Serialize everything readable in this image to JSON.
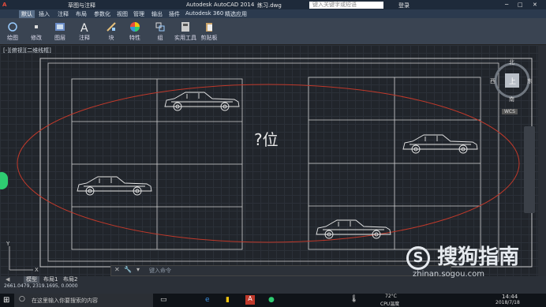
{
  "titlebar": {
    "workspace": "草图与注释",
    "app_title": "Autodesk AutoCAD 2014",
    "file": "练习.dwg",
    "search_placeholder": "键入关键字或短语",
    "login": "登录"
  },
  "tabs": [
    "默认",
    "插入",
    "注释",
    "布局",
    "参数化",
    "视图",
    "管理",
    "输出",
    "插件",
    "Autodesk 360",
    "精选应用"
  ],
  "ribbon": [
    "绘图",
    "修改",
    "图层",
    "注释",
    "块",
    "特性",
    "组",
    "实用工具",
    "剪贴板"
  ],
  "view_label": "[-][俯视][二维线框]",
  "viewcube": {
    "north": "北",
    "south": "南",
    "east": "东",
    "west": "西",
    "top": "上",
    "wcs": "WCS"
  },
  "canvas_text": "?位",
  "command_placeholder": "键入命令",
  "layout_tabs": [
    "模型",
    "布局1",
    "布局2"
  ],
  "coords": "2661.0479, 2319.1695, 0.0000",
  "taskbar": {
    "search_placeholder": "在这里输入你要搜索的内容",
    "temperature": "72°C",
    "cpu_label": "CPU温度",
    "time": "14:44",
    "date": "2018/7/18"
  },
  "watermark": {
    "brand": "搜狗指南",
    "url": "zhinan.sogou.com"
  },
  "colors": {
    "ellipse": "#c0392b",
    "lines": "#d9d9d9",
    "canvas": "#21252b"
  }
}
